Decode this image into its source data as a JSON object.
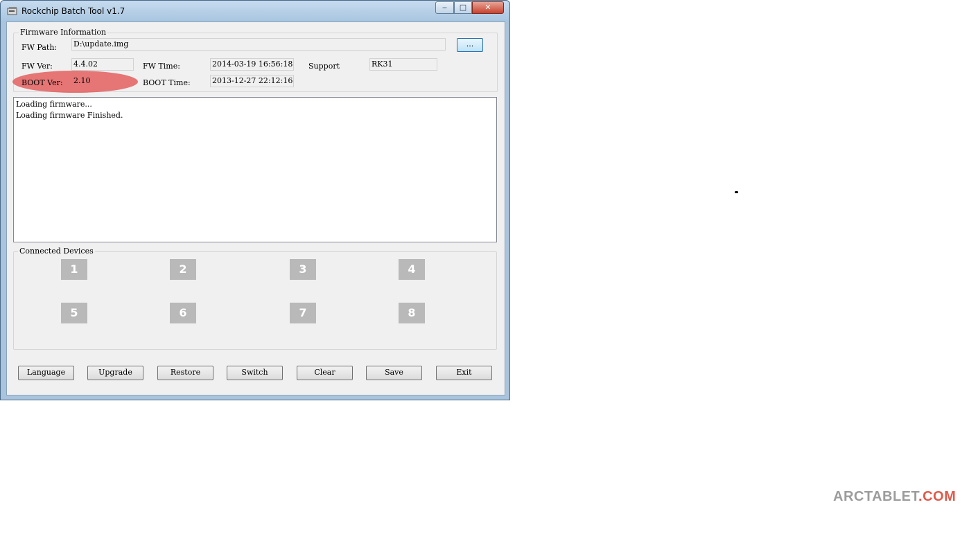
{
  "window": {
    "title": "Rockchip Batch Tool v1.7",
    "caption_buttons": {
      "minimize": "‒",
      "maximize": "□",
      "close": "✕"
    }
  },
  "firmware_info": {
    "group_title": "Firmware Information",
    "fw_path_label": "FW Path:",
    "fw_path_value": "D:\\update.img",
    "browse_label": "...",
    "fw_ver_label": "FW Ver:",
    "fw_ver_value": "4.4.02",
    "fw_time_label": "FW Time:",
    "fw_time_value": "2014-03-19 16:56:18",
    "support_label": "Support",
    "support_value": "RK31",
    "boot_ver_label": "BOOT Ver:",
    "boot_ver_value": "2.10",
    "boot_time_label": "BOOT Time:",
    "boot_time_value": "2013-12-27 22:12:16"
  },
  "log": {
    "lines": [
      "Loading firmware...",
      "Loading firmware Finished."
    ]
  },
  "devices": {
    "group_title": "Connected Devices",
    "slots": [
      "1",
      "2",
      "3",
      "4",
      "5",
      "6",
      "7",
      "8"
    ]
  },
  "buttons": {
    "language": "Language",
    "upgrade": "Upgrade",
    "restore": "Restore",
    "switch": "Switch",
    "clear": "Clear",
    "save": "Save",
    "exit": "Exit"
  },
  "watermark": {
    "main": "ARCTABLET",
    "suffix": ".COM"
  },
  "colors": {
    "highlight": "#e35252",
    "device_slot": "#b9b9b9",
    "watermark_gray": "#9c9c9c",
    "watermark_red": "#e05a4a"
  }
}
